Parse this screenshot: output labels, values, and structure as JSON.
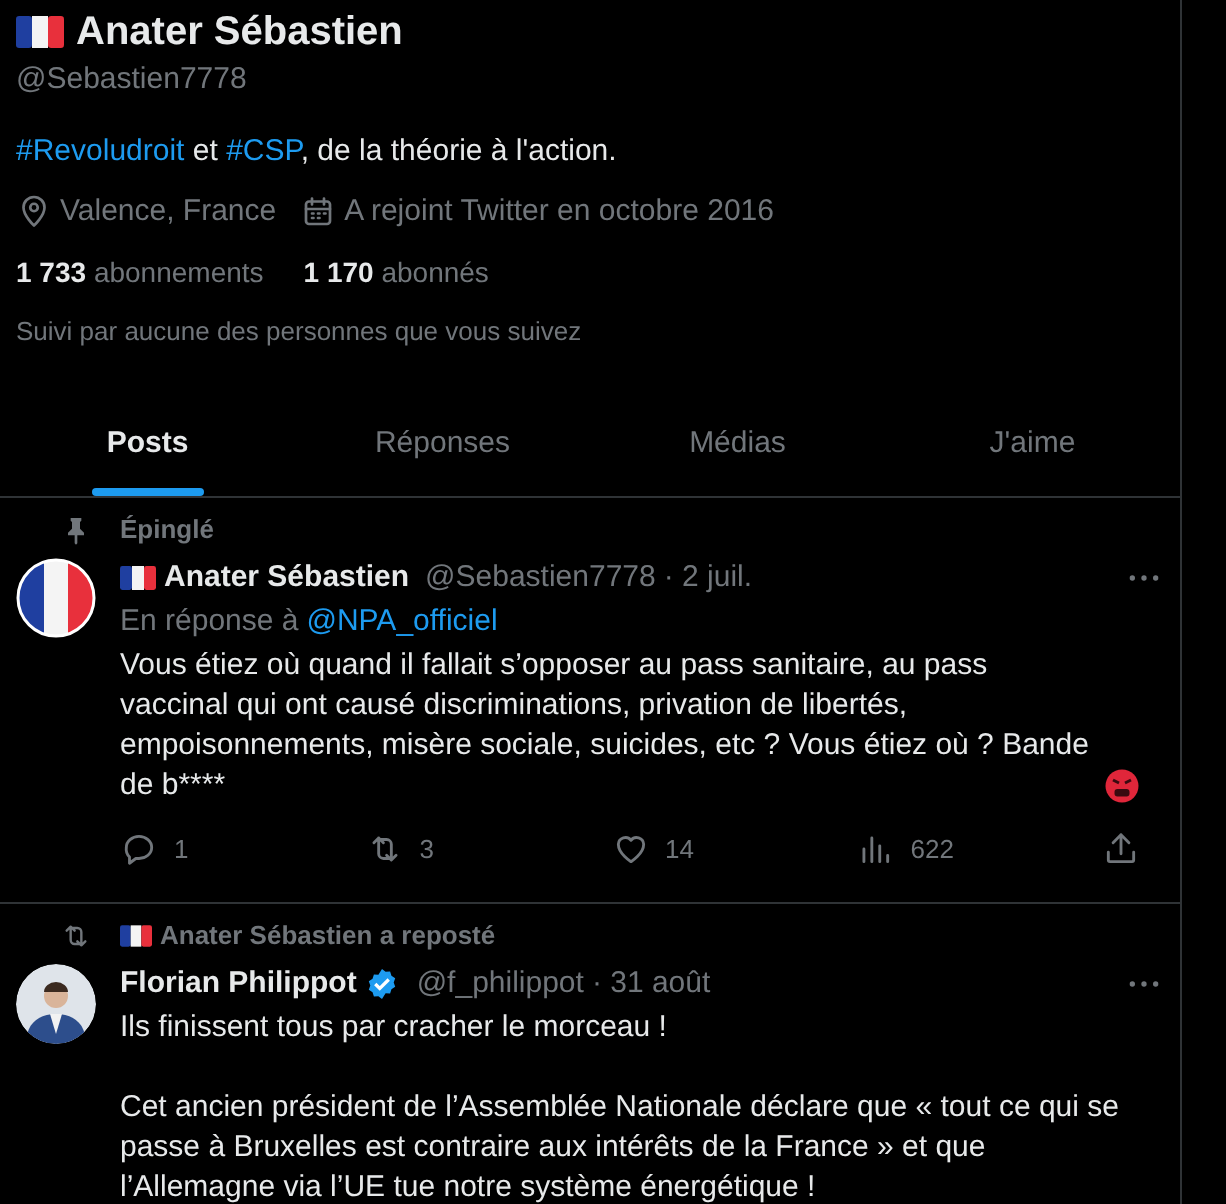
{
  "profile": {
    "name": "Anater Sébastien",
    "handle": "@Sebastien7778",
    "bio": [
      {
        "kind": "hashtag",
        "text": "#Revoludroit"
      },
      {
        "kind": "text",
        "text": " et "
      },
      {
        "kind": "hashtag",
        "text": "#CSP"
      },
      {
        "kind": "text",
        "text": ", de la théorie à l'action."
      }
    ],
    "location": "Valence, France",
    "joined": "A rejoint Twitter en octobre 2016",
    "following": {
      "count": "1 733",
      "label": "abonnements"
    },
    "followers": {
      "count": "1 170",
      "label": "abonnés"
    },
    "followed_by": "Suivi par aucune des personnes que vous suivez"
  },
  "tabs": [
    {
      "label": "Posts",
      "selected": true
    },
    {
      "label": "Réponses",
      "selected": false
    },
    {
      "label": "Médias",
      "selected": false
    },
    {
      "label": "J'aime",
      "selected": false
    }
  ],
  "posts": [
    {
      "context": {
        "kind": "pinned",
        "text": "Épinglé"
      },
      "avatar": {
        "kind": "flag"
      },
      "name": "Anater Sébastien",
      "flag": true,
      "verified": false,
      "handle": "@Sebastien7778",
      "date": "· 2 juil.",
      "reply_to": {
        "prefix": "En réponse à",
        "handle": "@NPA_officiel"
      },
      "paragraphs": [
        "Vous étiez où quand il fallait s’opposer au pass sanitaire, au pass vaccinal qui ont causé discriminations, privation de libertés, empoisonnements, misère sociale, suicides, etc ? Vous étiez où ? Bande de b****"
      ],
      "angry_emoji": true,
      "actions": {
        "replies": "1",
        "reposts": "3",
        "likes": "14",
        "views": "622"
      }
    },
    {
      "context": {
        "kind": "repost",
        "text": "Anater Sébastien a reposté"
      },
      "name": "Florian Philippot",
      "flag": false,
      "verified": true,
      "handle": "@f_philippot",
      "date": "· 31 août",
      "paragraphs": [
        "Ils finissent tous par cracher le morceau !",
        "Cet ancien président de l’Assemblée Nationale déclare que « tout ce qui se passe à Bruxelles est contraire aux intérêts de la France » et que l’Allemagne via l’UE tue notre système énergétique !"
      ],
      "angry_emoji": false
    }
  ]
}
